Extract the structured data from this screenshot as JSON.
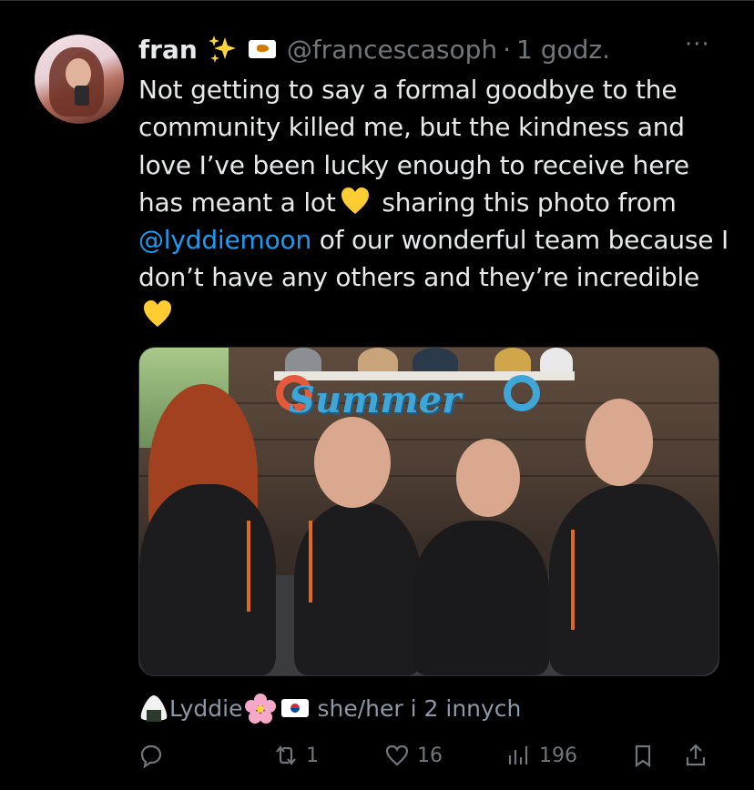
{
  "tweet": {
    "author_name": "fran",
    "author_handle": "@francescasoph",
    "separator": "·",
    "time": "1 godz.",
    "more_label": "···",
    "text_part1": "Not getting to say a formal goodbye to the community killed me, but the kindness and love I’ve been lucky enough to receive here has meant a lot",
    "text_part2": " sharing this photo from ",
    "mention": "@lyddiemoon",
    "text_part3": " of our wonderful team because I don’t have any others and they’re incredible",
    "emoji_icons": [
      "sparkles-icon",
      "cyprus-flag-icon",
      "yellow-heart-icon"
    ]
  },
  "media": {
    "sign_text": "Summer"
  },
  "tagged": {
    "name": "Lyddie",
    "suffix": "she/her i 2 innych",
    "icons": [
      "onigiri-icon",
      "cherry-blossom-icon",
      "south-korea-flag-icon"
    ]
  },
  "actions": {
    "reply_count": "",
    "retweet_count": "1",
    "like_count": "16",
    "views_count": "196"
  },
  "colors": {
    "background": "#000000",
    "text": "#e7e9ea",
    "muted": "#71767b",
    "link": "#1d9bf0"
  }
}
